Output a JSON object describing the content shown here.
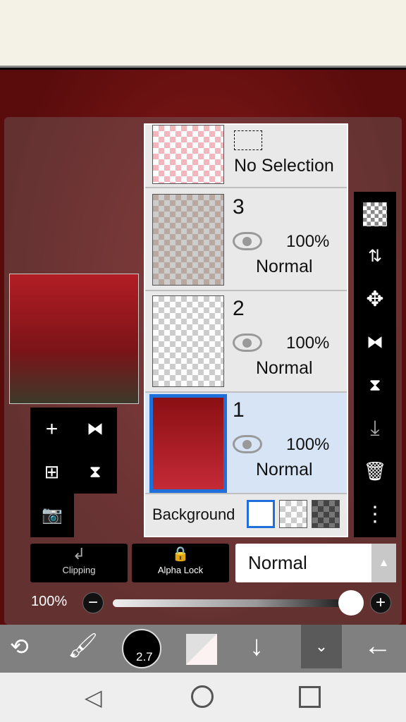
{
  "layers_panel": {
    "selection_row": {
      "label": "No Selection"
    },
    "layers": [
      {
        "number": "3",
        "opacity": "100%",
        "blend_mode": "Normal",
        "visible": true,
        "selected": false
      },
      {
        "number": "2",
        "opacity": "100%",
        "blend_mode": "Normal",
        "visible": true,
        "selected": false
      },
      {
        "number": "1",
        "opacity": "100%",
        "blend_mode": "Normal",
        "visible": true,
        "selected": true
      }
    ],
    "background": {
      "label": "Background",
      "options": [
        "white",
        "transparent",
        "dark-checker"
      ],
      "selected": "white"
    }
  },
  "right_toolbar": [
    "transparency-icon",
    "swap-layer-icon",
    "move-icon",
    "flip-horizontal-icon",
    "flip-vertical-icon",
    "merge-down-icon",
    "trash-icon",
    "more-icon"
  ],
  "bottom_controls": {
    "clipping_label": "Clipping",
    "alpha_lock_label": "Alpha Lock",
    "blend_mode": "Normal",
    "opacity_label": "100%",
    "opacity_value": 100
  },
  "toolbar": {
    "brush_size": "2.7"
  },
  "colors": {
    "selected_layer_bg": "#d6e4f5",
    "selected_border": "#1e6fd9",
    "canvas": "#7a1418"
  }
}
